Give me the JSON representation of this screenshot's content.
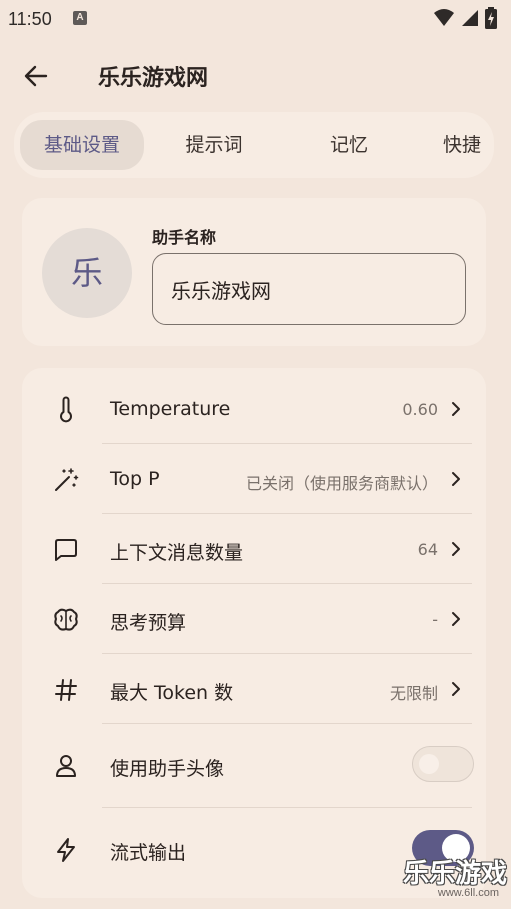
{
  "status_bar": {
    "time": "11:50",
    "notification_glyph": "A"
  },
  "header": {
    "title": "乐乐游戏网"
  },
  "tabs": [
    {
      "label": "基础设置",
      "active": true
    },
    {
      "label": "提示词",
      "active": false
    },
    {
      "label": "记忆",
      "active": false
    },
    {
      "label": "快捷",
      "active": false
    }
  ],
  "assistant": {
    "avatar_char": "乐",
    "name_label": "助手名称",
    "name_value": "乐乐游戏网"
  },
  "settings": [
    {
      "label": "Temperature",
      "value": "0.60",
      "icon": "thermometer-icon"
    },
    {
      "label": "Top P",
      "value": "已关闭（使用服务商默认）",
      "icon": "magic-wand-icon"
    },
    {
      "label": "上下文消息数量",
      "value": "64",
      "icon": "message-icon"
    },
    {
      "label": "思考预算",
      "value": "-",
      "icon": "brain-icon"
    },
    {
      "label": "最大 Token 数",
      "value": "无限制",
      "icon": "hash-icon"
    },
    {
      "label": "使用助手头像",
      "toggle": false,
      "icon": "user-icon"
    },
    {
      "label": "流式输出",
      "toggle": true,
      "icon": "lightning-icon"
    }
  ],
  "colors": {
    "accent": "#5d5a87",
    "background": "#f3e6dc",
    "card": "#f7ece3"
  },
  "watermark": {
    "text": "乐乐游戏",
    "sub": "www.6ll.com"
  }
}
